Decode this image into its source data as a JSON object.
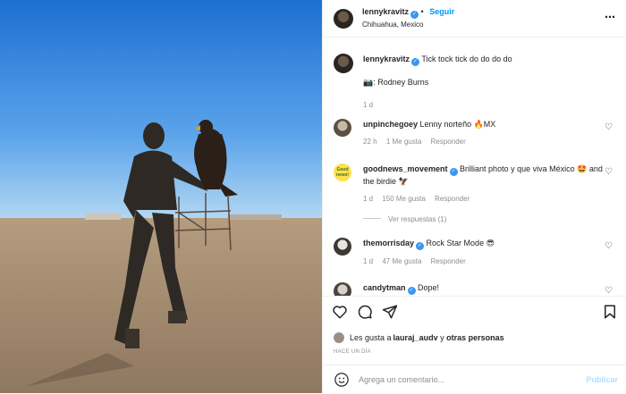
{
  "header": {
    "username": "lennykravitz",
    "follow_label": "Seguir",
    "location": "Chihuahua, Mexico",
    "separator": "•"
  },
  "caption": {
    "username": "lennykravitz",
    "text": "Tick tock tick do do do do",
    "credit": ": Rodney Burns",
    "time": "1 d"
  },
  "comments": [
    {
      "username": "unpinchegoey",
      "text": "Lenny norteño 🔥MX",
      "time": "22 h",
      "likes": "1 Me gusta",
      "reply": "Responder",
      "verified": false
    },
    {
      "username": "goodnews_movement",
      "text": "Brilliant photo y que viva México 🤩 and the birdie 🦅",
      "time": "1 d",
      "likes": "150 Me gusta",
      "reply": "Responder",
      "verified": true,
      "avatar_text": "Good news!"
    },
    {
      "username": "themorrisday",
      "text": "Rock Star Mode 😎",
      "time": "1 d",
      "likes": "47 Me gusta",
      "reply": "Responder",
      "verified": true
    },
    {
      "username": "candytman",
      "text": "Dope!",
      "verified": true
    }
  ],
  "view_replies": "Ver respuestas (1)",
  "likes_text": {
    "prefix": "Les gusta a ",
    "user": "lauraj_audv",
    "middle": " y ",
    "others": "otras personas"
  },
  "timestamp": "HACE UN DÍA",
  "add_comment": {
    "placeholder": "Agrega un comentario...",
    "publish_label": "Publicar"
  },
  "icons": [
    "heart-icon",
    "comment-icon",
    "share-icon",
    "bookmark-icon",
    "emoji-icon",
    "more-icon",
    "camera-icon"
  ],
  "colors": {
    "link_blue": "#0095f6",
    "verified_blue": "#3897f0",
    "sky_top": "#2f7fd8",
    "sky_bottom": "#9ecbf0",
    "ground": "#a88f72"
  }
}
